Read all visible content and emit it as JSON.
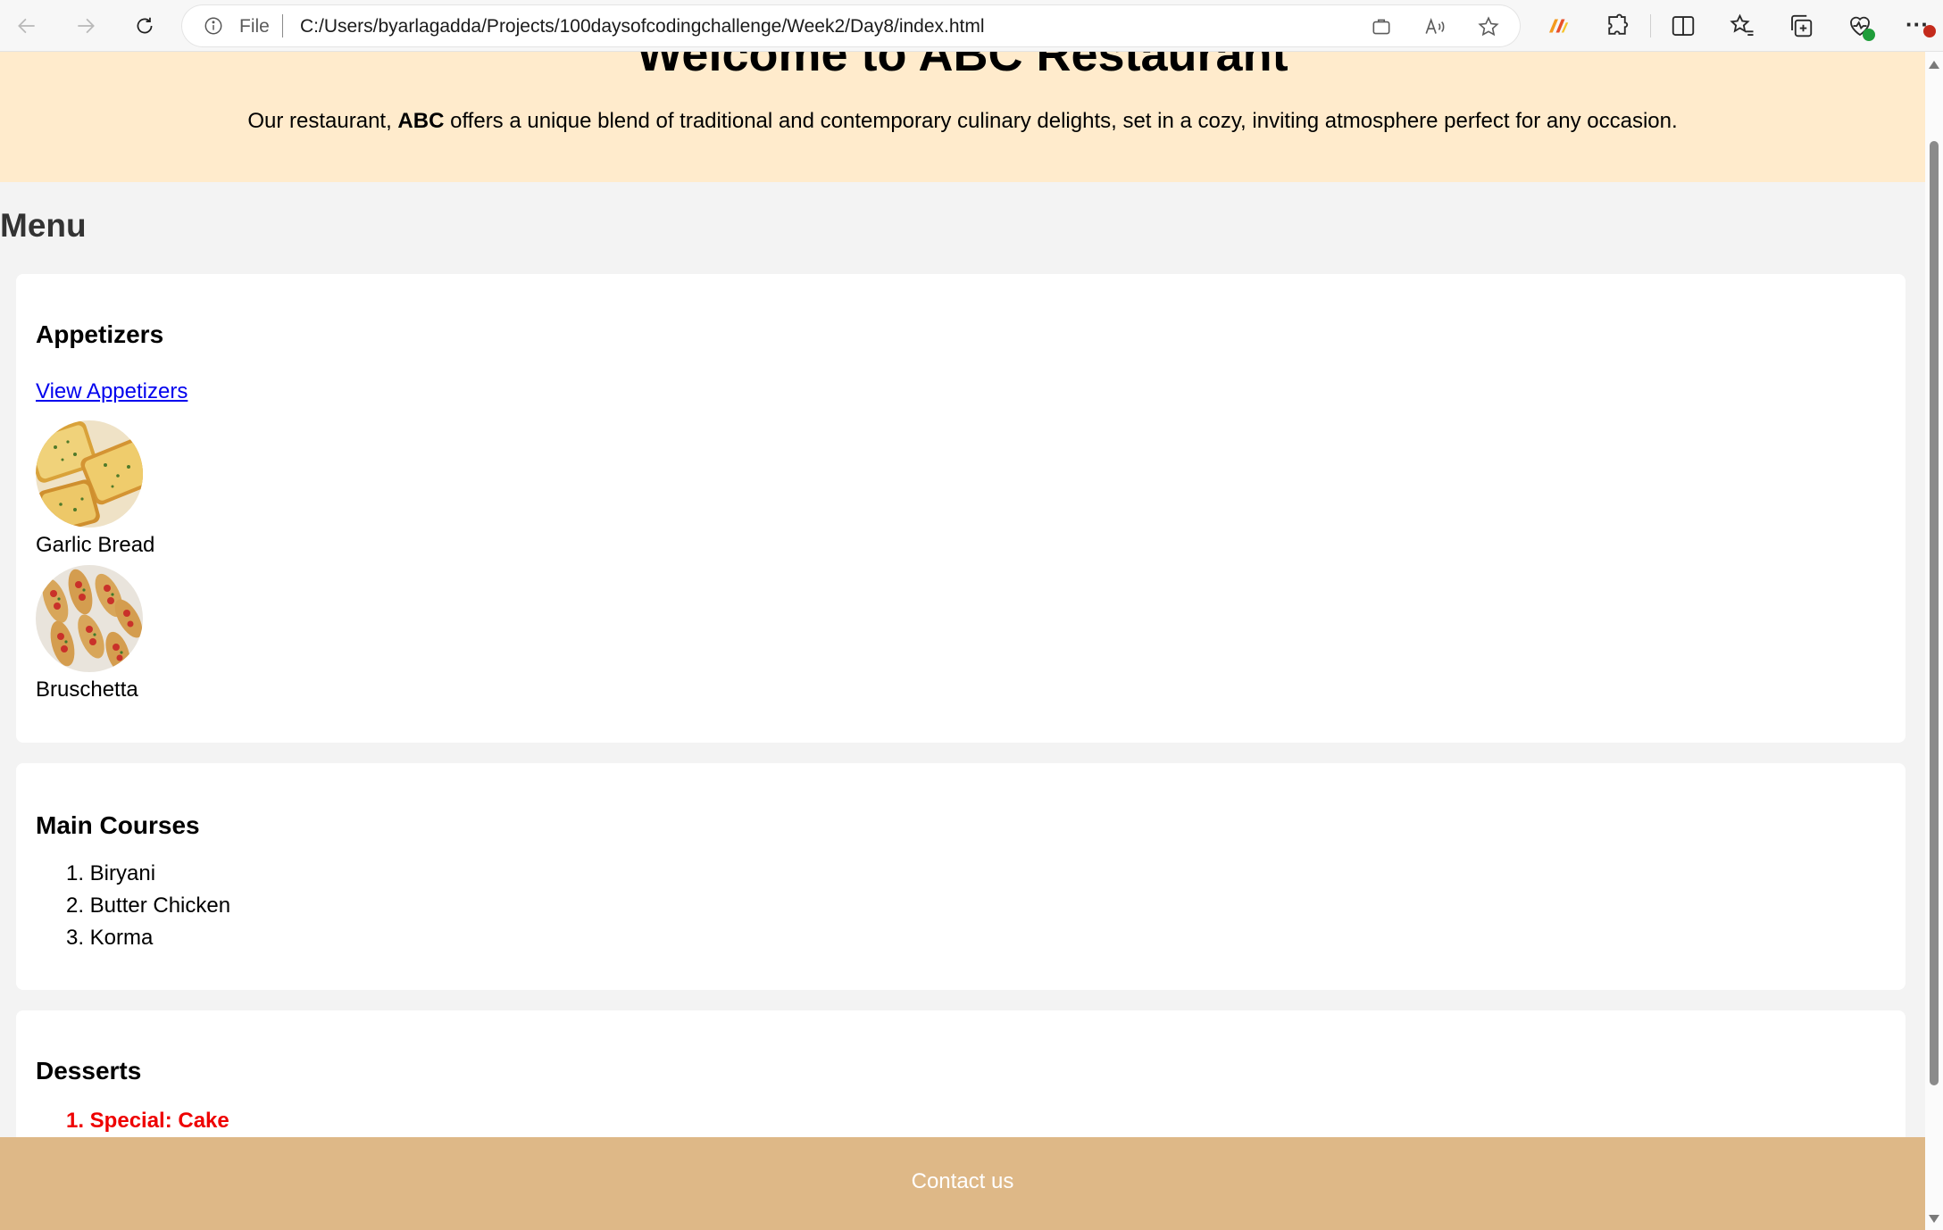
{
  "browser": {
    "address_scheme": "File",
    "url": "C:/Users/byarlagadda/Projects/100daysofcodingchallenge/Week2/Day8/index.html",
    "more_label": "···"
  },
  "page": {
    "title": "Welcome to ABC Restaurant",
    "intro_before": "Our restaurant, ",
    "intro_brand": "ABC",
    "intro_after": " offers a unique blend of traditional and contemporary culinary delights, set in a cozy, inviting atmosphere perfect for any occasion.",
    "menu_heading": "Menu"
  },
  "appetizers": {
    "title": "Appetizers",
    "link": "View Appetizers",
    "items": [
      {
        "name": "Garlic Bread"
      },
      {
        "name": "Bruschetta"
      }
    ]
  },
  "main_courses": {
    "title": "Main Courses",
    "items": [
      {
        "num": "1.",
        "name": "Biryani"
      },
      {
        "num": "2.",
        "name": "Butter Chicken"
      },
      {
        "num": "3.",
        "name": "Korma"
      }
    ]
  },
  "desserts": {
    "title": "Desserts",
    "items": [
      {
        "num": "1.",
        "name": "Special: Cake"
      }
    ]
  },
  "footer": {
    "link": "Contact us"
  },
  "colors": {
    "header_bg": "#ffebcc",
    "page_bg": "#f3f3f3",
    "footer_bg": "#deb887",
    "link": "#0000ee",
    "special": "#ee0000"
  }
}
